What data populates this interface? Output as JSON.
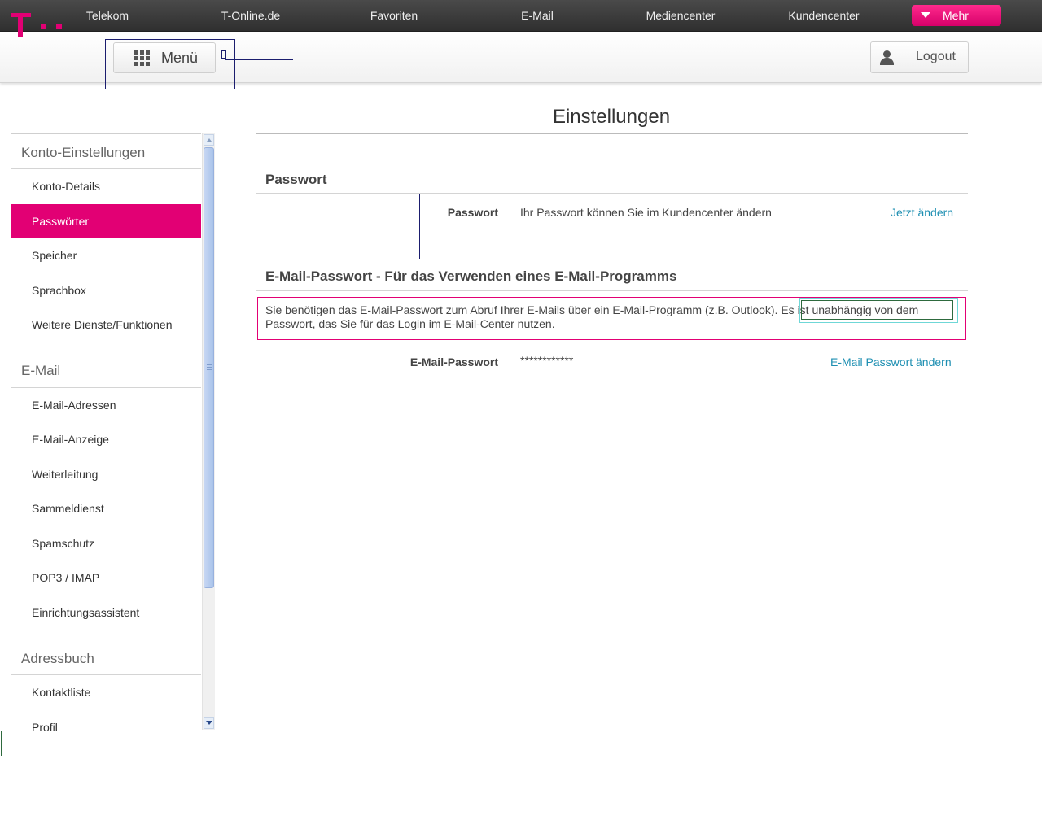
{
  "topnav": {
    "items": [
      "Telekom",
      "T-Online.de",
      "Favoriten",
      "E-Mail",
      "Mediencenter",
      "Kundencenter"
    ],
    "more_label": "Mehr"
  },
  "header": {
    "menu_label": "Menü",
    "logout_label": "Logout"
  },
  "sidebar": {
    "groups": [
      {
        "title": "Konto-Einstellungen",
        "items": [
          "Konto-Details",
          "Passwörter",
          "Speicher",
          "Sprachbox",
          "Weitere Dienste/Funktionen"
        ]
      },
      {
        "title": "E-Mail",
        "items": [
          "E-Mail-Adressen",
          "E-Mail-Anzeige",
          "Weiterleitung",
          "Sammeldienst",
          "Spamschutz",
          "POP3 / IMAP",
          "Einrichtungsassistent"
        ]
      },
      {
        "title": "Adressbuch",
        "items": [
          "Kontaktliste",
          "Profil"
        ]
      }
    ],
    "active_item": "Passwörter"
  },
  "main": {
    "title": "Einstellungen",
    "password_section": {
      "title": "Passwort",
      "label": "Passwort",
      "text": "Ihr Passwort können Sie im Kundencenter ändern",
      "link": "Jetzt ändern"
    },
    "email_password_section": {
      "title": "E-Mail-Passwort - Für das Verwenden eines E-Mail-Programms",
      "info_line1": "Sie benötigen das E-Mail-Passwort zum Abruf Ihrer E-Mails über ein E-Mail-Programm (z.B. Outlook).",
      "info_highlight": "Es ist unabhängig von dem",
      "info_line2": "Passwort, das Sie für das Login im E-Mail-Center nutzen.",
      "label": "E-Mail-Passwort",
      "value": "************",
      "link": "E-Mail Passwort ändern"
    }
  },
  "colors": {
    "brand": "#e20074",
    "link": "#1e8fb2"
  }
}
